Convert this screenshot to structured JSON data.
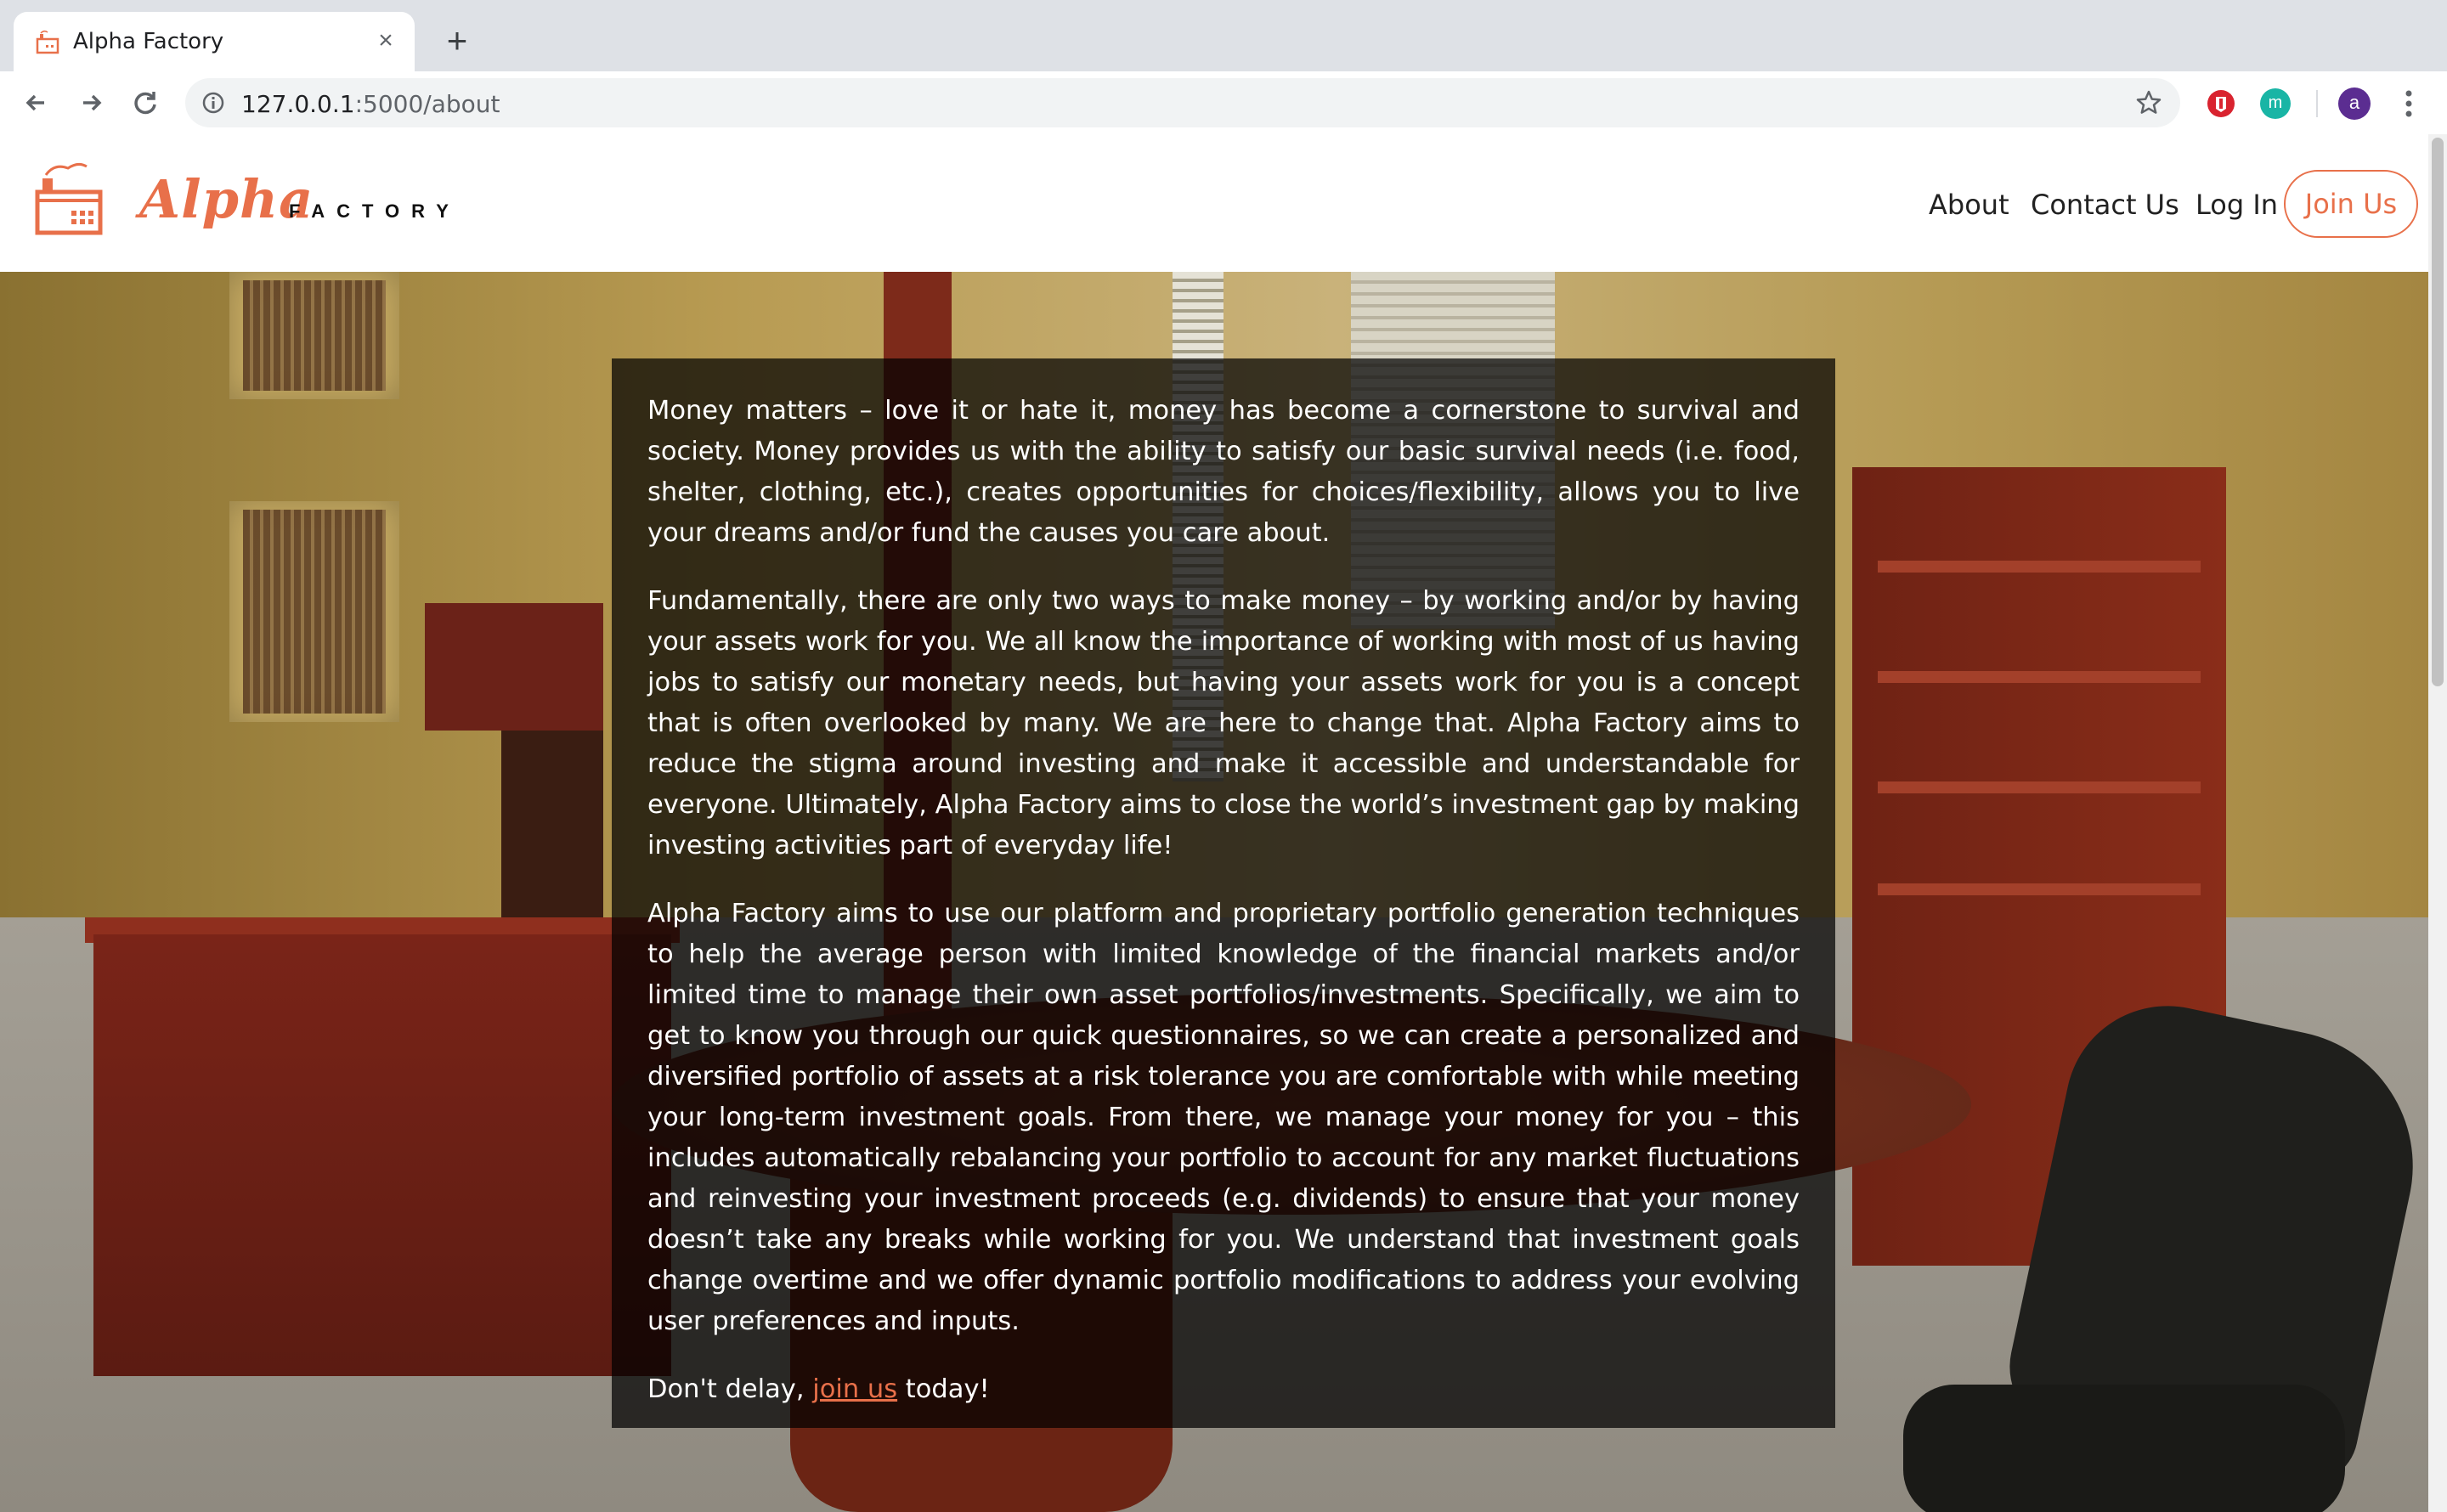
{
  "browser": {
    "tab_title": "Alpha Factory",
    "url_host": "127.0.0.1",
    "url_rest": ":5000/about",
    "avatar_letter": "a",
    "ext_teal_letter": "m"
  },
  "site": {
    "logo_text_alpha": "Alpha",
    "logo_text_factory": "FACTORY",
    "accent_color": "#e8704a",
    "nav": {
      "about": "About",
      "contact": "Contact Us",
      "login": "Log In",
      "join": "Join Us"
    }
  },
  "about": {
    "p1": "Money matters – love it or hate it, money has become a cornerstone to survival and society. Money provides us with the ability to satisfy our basic survival needs (i.e. food, shelter, clothing, etc.), creates opportunities for choices/flexibility, allows you to live your dreams and/or fund the causes you care about.",
    "p2": "Fundamentally, there are only two ways to make money – by working and/or by having your assets work for you. We all know the importance of working with most of us having jobs to satisfy our monetary needs, but having your assets work for you is a concept that is often overlooked by many. We are here to change that. Alpha Factory aims to reduce the stigma around investing and make it accessible and understandable for everyone. Ultimately, Alpha Factory aims to close the world’s investment gap by making investing activities part of everyday life!",
    "p3": "Alpha Factory aims to use our platform and proprietary portfolio generation techniques to help the average person with limited knowledge of the financial markets and/or limited time to manage their own asset portfolios/investments. Specifically, we aim to get to know you through our quick questionnaires, so we can create a personalized and diversified portfolio of assets at a risk tolerance you are comfortable with while meeting your long-term investment goals. From there, we manage your money for you – this includes automatically rebalancing your portfolio to account for any market fluctuations and reinvesting your investment proceeds (e.g. dividends) to ensure that your money doesn’t take any breaks while working for you. We understand that investment goals change overtime and we offer dynamic portfolio modifications to address your evolving user preferences and inputs.",
    "cta_prefix": "Don't delay, ",
    "cta_link": "join us",
    "cta_suffix": " today!"
  }
}
